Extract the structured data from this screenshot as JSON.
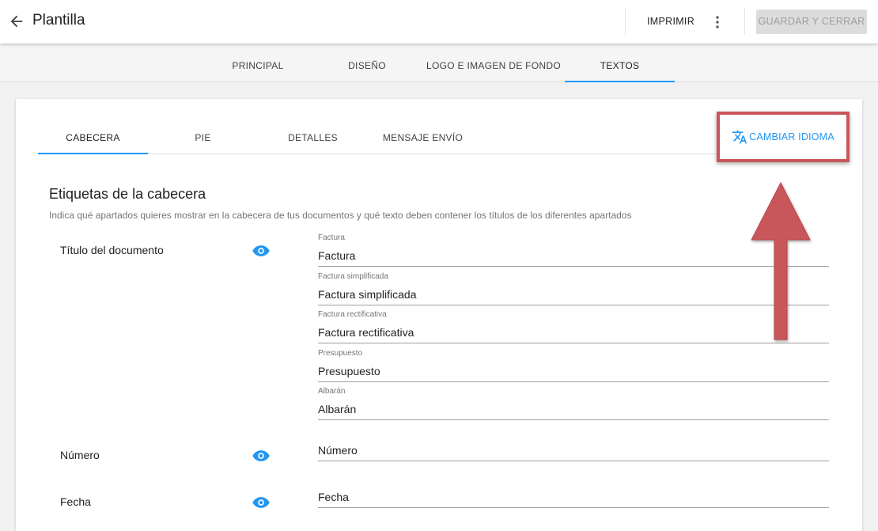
{
  "header": {
    "title": "Plantilla",
    "print_label": "IMPRIMIR",
    "save_label": "GUARDAR Y CERRAR"
  },
  "main_tabs": [
    {
      "label": "PRINCIPAL",
      "active": false
    },
    {
      "label": "DISEÑO",
      "active": false
    },
    {
      "label": "LOGO E IMAGEN DE FONDO",
      "active": false
    },
    {
      "label": "TEXTOS",
      "active": true
    }
  ],
  "sub_tabs": [
    {
      "label": "CABECERA",
      "active": true
    },
    {
      "label": "PIE",
      "active": false
    },
    {
      "label": "DETALLES",
      "active": false
    },
    {
      "label": "MENSAJE ENVÍO",
      "active": false
    }
  ],
  "language_button": {
    "label": "CAMBIAR IDIOMA",
    "icon": "translate-icon"
  },
  "annotation": {
    "color": "#c9565a"
  },
  "section": {
    "title": "Etiquetas de la cabecera",
    "description": "Indica qué apartados quieres mostrar en la cabecera de tus documentos y qué texto deben contener los títulos de los diferentes apartados"
  },
  "rows": [
    {
      "label": "Título del documento",
      "visible": true,
      "fields": [
        {
          "label": "Factura",
          "value": "Factura"
        },
        {
          "label": "Factura simplificada",
          "value": "Factura simplificada"
        },
        {
          "label": "Factura rectificativa",
          "value": "Factura rectificativa"
        },
        {
          "label": "Presupuesto",
          "value": "Presupuesto"
        },
        {
          "label": "Albarán",
          "value": "Albarán"
        }
      ]
    },
    {
      "label": "Número",
      "visible": true,
      "fields": [
        {
          "value": "Número"
        }
      ]
    },
    {
      "label": "Fecha",
      "visible": true,
      "fields": [
        {
          "value": "Fecha"
        }
      ]
    }
  ],
  "colors": {
    "accent": "#2196f3",
    "disabled_bg": "#dcdcdc"
  }
}
